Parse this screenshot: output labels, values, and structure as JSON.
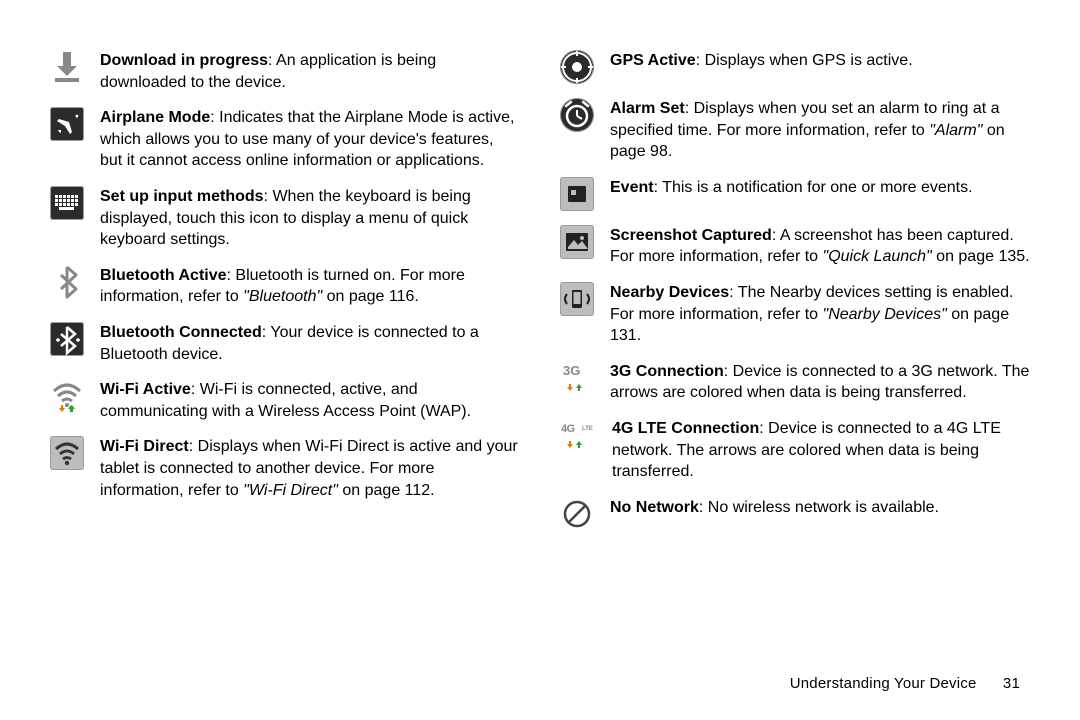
{
  "footer": {
    "section": "Understanding Your Device",
    "page": "31"
  },
  "left": [
    {
      "icon": "download",
      "title": "Download in progress",
      "body": ": An application is being downloaded to the device."
    },
    {
      "icon": "airplane",
      "title": "Airplane Mode",
      "body": ": Indicates that the Airplane Mode is active, which allows you to use many of your device's features, but it cannot access online information or applications."
    },
    {
      "icon": "keyboard",
      "title": "Set up input methods",
      "body": ": When the keyboard is being displayed, touch this icon to display a menu of quick keyboard settings."
    },
    {
      "icon": "bt",
      "title": "Bluetooth Active",
      "body": ": Bluetooth is turned on. For more information, refer to ",
      "ref": "\"Bluetooth\"",
      "tail": " on page 116."
    },
    {
      "icon": "bt-conn",
      "title": "Bluetooth Connected",
      "body": ": Your device is connected to a Bluetooth device."
    },
    {
      "icon": "wifi-active",
      "title": "Wi-Fi Active",
      "body": ": Wi-Fi is connected, active, and communicating with a Wireless Access Point (WAP)."
    },
    {
      "icon": "wifi-direct",
      "title": "Wi-Fi Direct",
      "body": ": Displays when Wi-Fi Direct is active and your tablet is connected to another device. For more information, refer to ",
      "ref": "\"Wi-Fi Direct\"",
      "tail": " on page 112."
    }
  ],
  "right": [
    {
      "icon": "gps",
      "title": "GPS Active",
      "body": ": Displays when GPS is active."
    },
    {
      "icon": "alarm",
      "title": "Alarm Set",
      "body": ": Displays when you set an alarm to ring at a specified time. For more information, refer to ",
      "ref": "\"Alarm\"",
      "tail": " on page 98."
    },
    {
      "icon": "event",
      "title": "Event",
      "body": ": This is a notification for one or more events."
    },
    {
      "icon": "screenshot",
      "title": "Screenshot Captured",
      "body": ": A screenshot has been captured. For more information, refer to ",
      "ref": "\"Quick Launch\"",
      "tail": " on page 135."
    },
    {
      "icon": "nearby",
      "title": "Nearby Devices",
      "body": ": The Nearby devices setting is enabled. For more information, refer to ",
      "ref": "\"Nearby Devices\"",
      "tail": " on page 131."
    },
    {
      "icon": "3g",
      "title": "3G Connection",
      "body": ": Device is connected to a 3G network. The arrows are colored when data is being transferred."
    },
    {
      "icon": "4g",
      "title": "4G LTE Connection",
      "body": ": Device is connected to a 4G LTE network. The arrows are colored when data is being transferred."
    },
    {
      "icon": "no-net",
      "title": "No Network",
      "body": ": No wireless network is available."
    }
  ]
}
